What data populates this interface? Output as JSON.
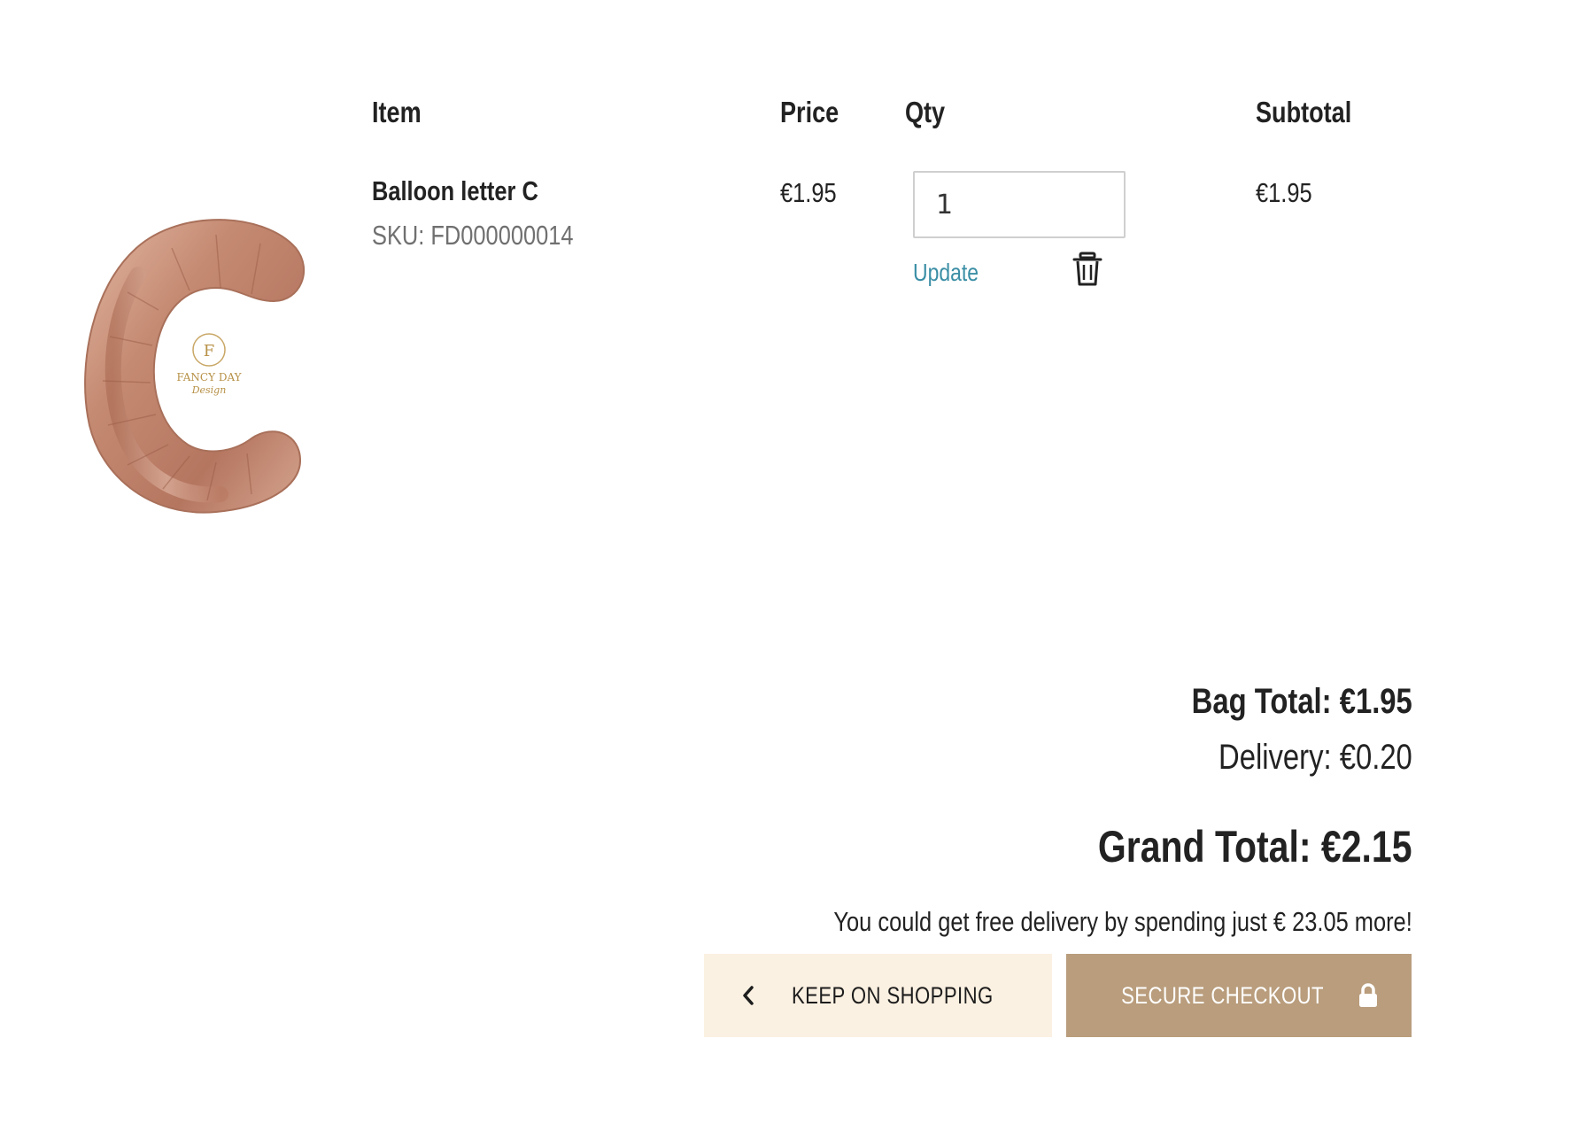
{
  "cart": {
    "headers": {
      "item": "Item",
      "price": "Price",
      "qty": "Qty",
      "subtotal": "Subtotal"
    },
    "items": [
      {
        "name": "Balloon letter C",
        "sku": "SKU: FD000000014",
        "price": "€1.95",
        "qty": "1",
        "subtotal": "€1.95",
        "update_label": "Update",
        "image_logo_text": [
          "F",
          "FANCY DAY",
          "Design"
        ]
      }
    ]
  },
  "summary": {
    "bag_total": "Bag Total: €1.95",
    "delivery": "Delivery: €0.20",
    "grand_total": "Grand Total: €2.15",
    "free_delivery_message": "You could get free delivery by spending just € 23.05 more!"
  },
  "actions": {
    "keep_shopping_label": "KEEP ON SHOPPING",
    "checkout_label": "SECURE CHECKOUT"
  },
  "icons": {
    "back": "chevron-left-icon",
    "delete": "trash-icon",
    "checkout": "lock-icon"
  },
  "colors": {
    "link": "#3a8ea5",
    "keep_shopping_bg": "#fbf1e2",
    "checkout_bg": "#b99d7c",
    "balloon": "#c8907a"
  }
}
